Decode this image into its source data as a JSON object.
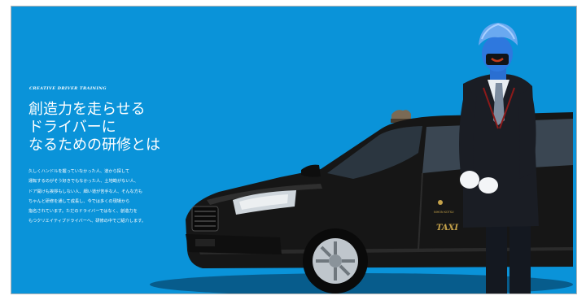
{
  "hero": {
    "kicker": "CREATIVE DRIVER TRAINING",
    "headline_lines": [
      "創造力を走らせる",
      "ドライバーに",
      "なるための研修とは"
    ],
    "body_lines": [
      "久しくハンドルを握っていなかった人、道から探して",
      "運転するのがそう好きでもなかった人、土地勘がない人、",
      "ドア開けも挨拶もしない人、細い道が苦手な人、そんな方も",
      "ちゃんと研修を通して成長し、今では多くの現場から",
      "指名されています。ただのドライバーではなく、創造力を",
      "もつクリエイティブドライバーへ、研修の中でご紹介します。"
    ]
  },
  "vehicle": {
    "door_label": "TAXI",
    "company_label": "NIHON KOTSU"
  },
  "colors": {
    "background": "#0a93d9",
    "car_body": "#161616",
    "character_skin": "#2e78de",
    "uniform": "#1a1d24"
  }
}
